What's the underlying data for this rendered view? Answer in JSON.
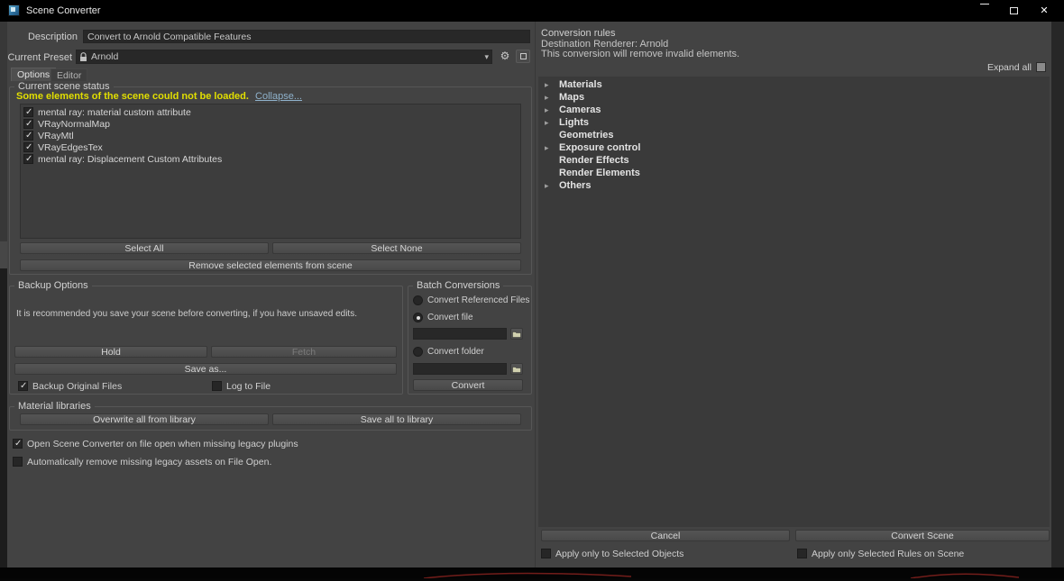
{
  "colors": {
    "warning": "#e2df00",
    "link": "#8fb2cc",
    "dialog_bg": "#434343",
    "panel_bg": "#3a3a3a"
  },
  "window": {
    "title": "Scene Converter",
    "icons": {
      "close": "✕"
    }
  },
  "header": {
    "description_label": "Description",
    "description_value": "Convert to Arnold Compatible Features",
    "preset_label": "Current Preset",
    "preset_value": "Arnold",
    "gear_icon": "⚙",
    "dropdown_icon": "▾"
  },
  "tabs": {
    "options": "Options",
    "editor": "Editor"
  },
  "scene_status": {
    "title": "Current scene status",
    "warning": "Some elements of the scene could not be loaded.",
    "collapse_link": "Collapse...",
    "items": [
      {
        "label": "mental ray: material custom attribute",
        "checked": true
      },
      {
        "label": "VRayNormalMap",
        "checked": true
      },
      {
        "label": "VRayMtl",
        "checked": true
      },
      {
        "label": "VRayEdgesTex",
        "checked": true
      },
      {
        "label": "mental ray: Displacement Custom Attributes",
        "checked": true
      }
    ],
    "select_all": "Select All",
    "select_none": "Select None",
    "remove_selected": "Remove selected elements from scene"
  },
  "backup": {
    "title": "Backup Options",
    "note": "It is recommended you save your scene before converting, if you have unsaved edits.",
    "hold": "Hold",
    "fetch": "Fetch",
    "save_as": "Save as...",
    "backup_original": {
      "label": "Backup Original Files",
      "checked": true
    },
    "log_to_file": {
      "label": "Log to File",
      "checked": false
    }
  },
  "batch": {
    "title": "Batch Conversions",
    "referenced": {
      "label": "Convert Referenced Files",
      "checked": false
    },
    "file": {
      "label": "Convert file",
      "checked": true
    },
    "folder": {
      "label": "Convert folder",
      "checked": false
    },
    "file_path": "",
    "folder_path": "",
    "convert": "Convert"
  },
  "materials": {
    "title": "Material libraries",
    "overwrite": "Overwrite all from library",
    "save_all": "Save all to library"
  },
  "footer": {
    "open_on_missing": {
      "label": "Open Scene Converter on file open when missing legacy plugins",
      "checked": true
    },
    "auto_remove": {
      "label": "Automatically remove missing legacy assets on File Open.",
      "checked": false
    }
  },
  "rules": {
    "title": "Conversion rules",
    "destination": "Destination Renderer: Arnold",
    "note": "This conversion will remove invalid elements.",
    "expand_all": {
      "label": "Expand all",
      "checked": false
    },
    "tree": [
      {
        "arrow": "▸",
        "label": "Materials"
      },
      {
        "arrow": "▸",
        "label": "Maps"
      },
      {
        "arrow": "▸",
        "label": "Cameras"
      },
      {
        "arrow": "▸",
        "label": "Lights"
      },
      {
        "arrow": "",
        "label": "Geometries"
      },
      {
        "arrow": "▸",
        "label": "Exposure control"
      },
      {
        "arrow": "",
        "label": "Render Effects"
      },
      {
        "arrow": "",
        "label": "Render Elements"
      },
      {
        "arrow": "▸",
        "label": "Others"
      }
    ],
    "cancel": "Cancel",
    "convert_scene": "Convert Scene",
    "apply_objects": {
      "label": "Apply only to Selected Objects",
      "checked": false
    },
    "apply_rules": {
      "label": "Apply only Selected Rules on Scene",
      "checked": false
    }
  }
}
